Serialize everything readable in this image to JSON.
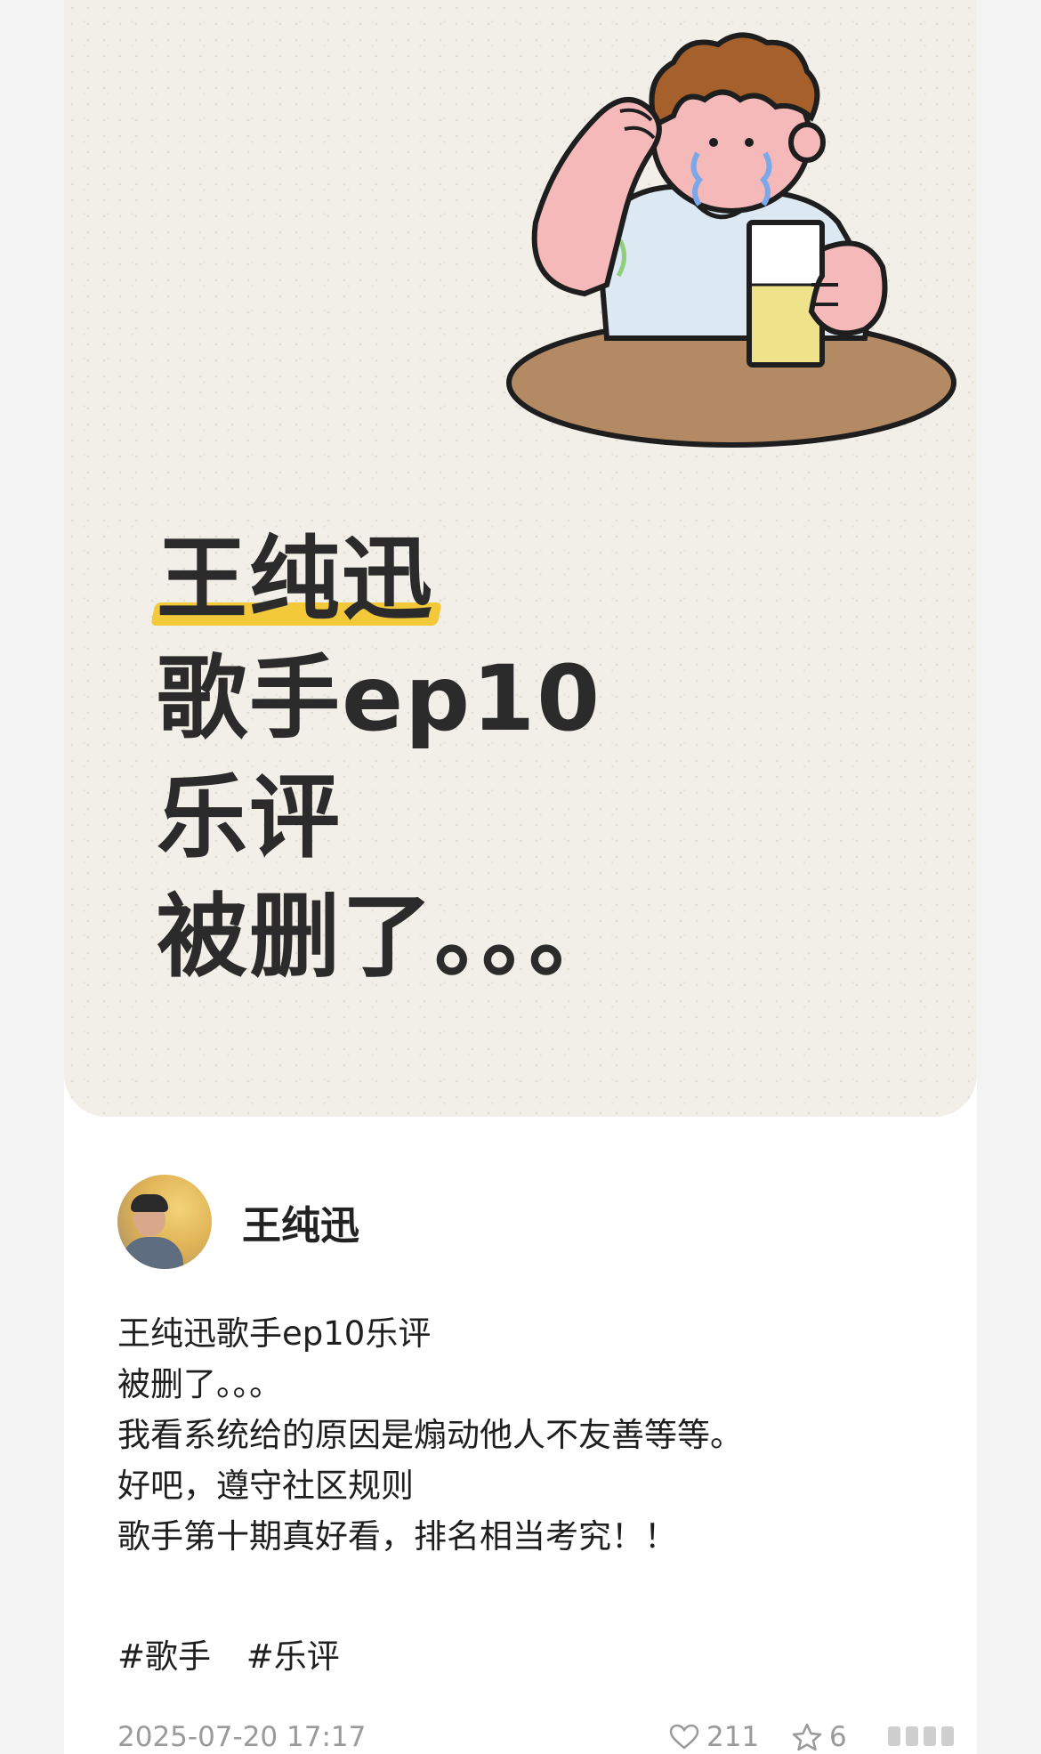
{
  "cover": {
    "title_line1": "王纯迅",
    "title_line2": "歌手ep10",
    "title_line3": "乐评",
    "title_line4": "被删了。。。"
  },
  "author": {
    "name": "王纯迅"
  },
  "post": {
    "lines": [
      "王纯迅歌手ep10乐评",
      "被删了。。。",
      "我看系统给的原因是煽动他人不友善等等。",
      "好吧，遵守社区规则",
      "歌手第十期真好看，排名相当考究！！"
    ],
    "tags": [
      "#歌手",
      "#乐评"
    ]
  },
  "meta": {
    "date": "2025-07-20 17:17",
    "likes": "211",
    "favorites": "6"
  },
  "colors": {
    "cover_bg": "#f1efe8",
    "highlight": "#f3c93a",
    "text": "#2b2b2b",
    "meta_text": "#9a9a9a"
  }
}
